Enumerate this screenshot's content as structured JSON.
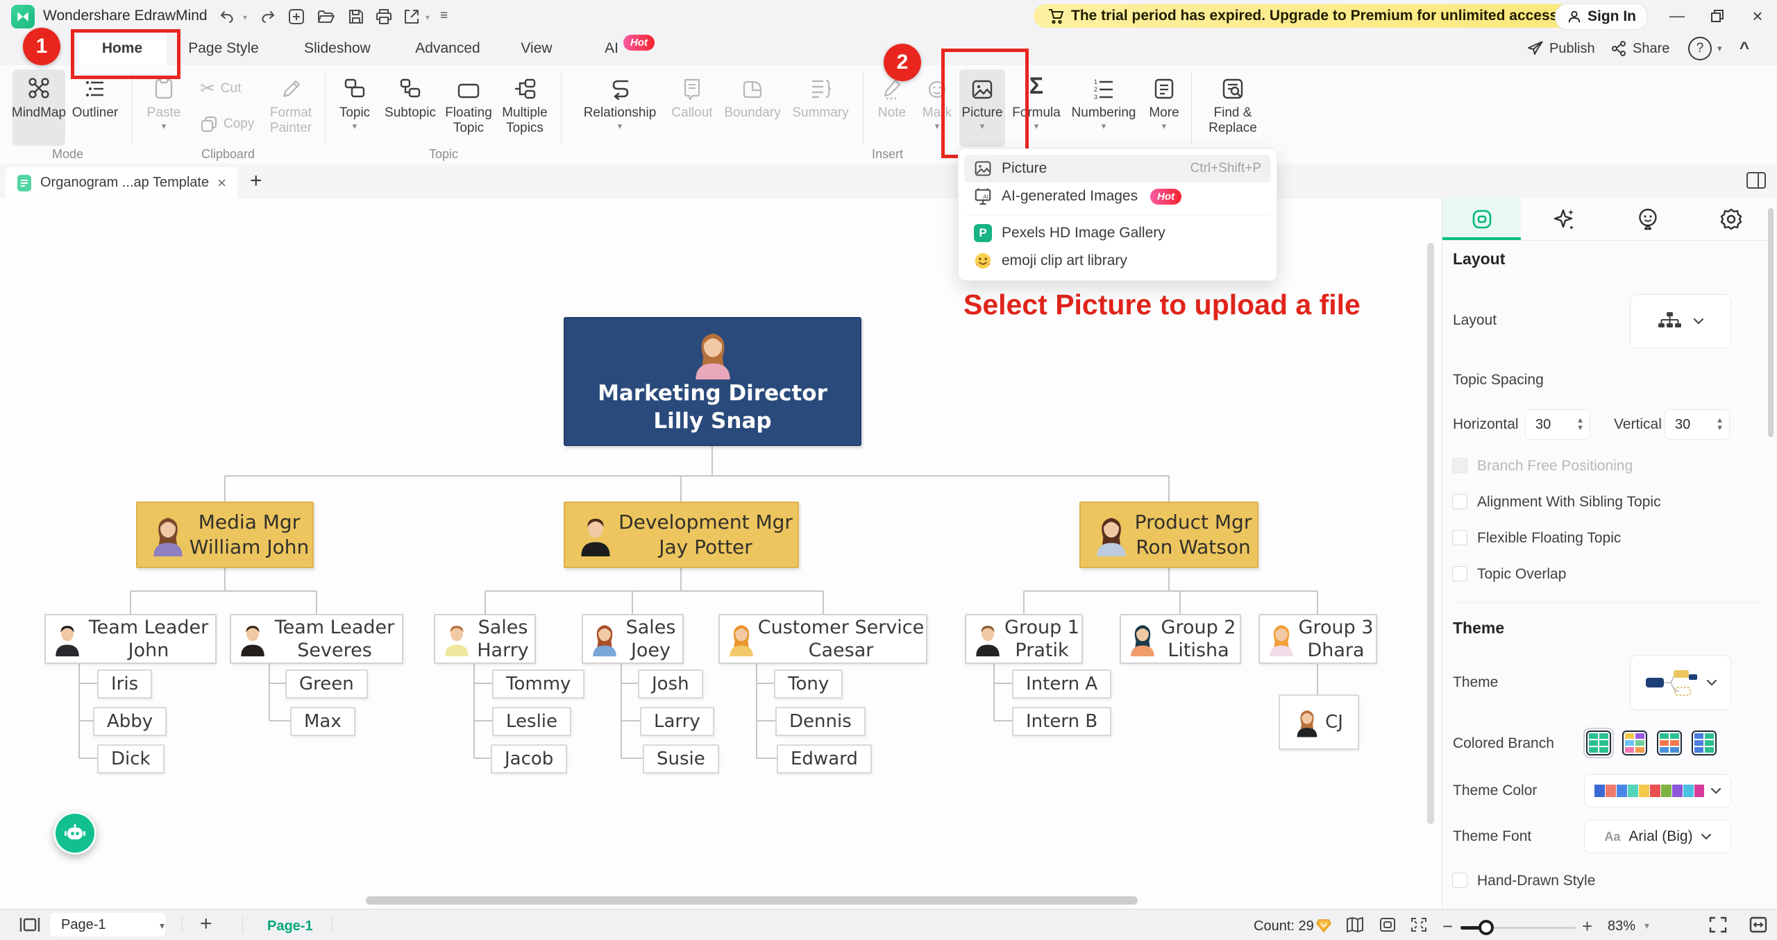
{
  "titlebar": {
    "app_title": "Wondershare EdrawMind",
    "trial_banner": "The trial period has expired. Upgrade to Premium for unlimited access.",
    "sign_in": "Sign In"
  },
  "tabs": {
    "home": "Home",
    "page_style": "Page Style",
    "slideshow": "Slideshow",
    "advanced": "Advanced",
    "view": "View",
    "ai": "AI",
    "ai_badge": "Hot"
  },
  "topright": {
    "publish": "Publish",
    "share": "Share",
    "help": "?",
    "collapse": "^"
  },
  "ribbon": {
    "mindmap": "MindMap",
    "outliner": "Outliner",
    "mode_group": "Mode",
    "paste": "Paste",
    "cut": "Cut",
    "copy": "Copy",
    "format_painter": [
      "Format",
      "Painter"
    ],
    "clipboard_group": "Clipboard",
    "topic": "Topic",
    "subtopic": "Subtopic",
    "floating_topic": [
      "Floating",
      "Topic"
    ],
    "multiple_topics": [
      "Multiple",
      "Topics"
    ],
    "topic_group": "Topic",
    "relationship": "Relationship",
    "callout": "Callout",
    "boundary": "Boundary",
    "summary": "Summary",
    "note": "Note",
    "mark": "Mark",
    "picture": "Picture",
    "formula": "Formula",
    "numbering": "Numbering",
    "more": "More",
    "insert_group": "Insert",
    "find_replace": [
      "Find &",
      "Replace"
    ]
  },
  "annotations": {
    "step1": "1",
    "step2": "2",
    "callout_text": "Select Picture to upload a file"
  },
  "doc_tab": {
    "title": "Organogram ...ap Template"
  },
  "picture_menu": {
    "items": [
      {
        "label": "Picture",
        "shortcut": "Ctrl+Shift+P"
      },
      {
        "label": "AI-generated Images",
        "badge": "Hot"
      },
      {
        "label": "Pexels HD Image Gallery"
      },
      {
        "label": "emoji clip art library"
      }
    ]
  },
  "org": {
    "root": {
      "line1": "Marketing Director",
      "line2": "Lilly Snap"
    },
    "managers": [
      {
        "line1": "Media Mgr",
        "line2": "William John"
      },
      {
        "line1": "Development Mgr",
        "line2": "Jay Potter"
      },
      {
        "line1": "Product Mgr",
        "line2": "Ron Watson"
      }
    ],
    "level3": [
      {
        "line1": "Team Leader",
        "line2": "John"
      },
      {
        "line1": "Team Leader",
        "line2": "Severes"
      },
      {
        "line1": "Sales",
        "line2": "Harry"
      },
      {
        "line1": "Sales",
        "line2": "Joey"
      },
      {
        "line1": "Customer Service",
        "line2": "Caesar"
      },
      {
        "line1": "Group 1",
        "line2": "Pratik"
      },
      {
        "line1": "Group 2",
        "line2": "Litisha"
      },
      {
        "line1": "Group 3",
        "line2": "Dhara"
      }
    ],
    "leaves": {
      "john": [
        "Iris",
        "Abby",
        "Dick"
      ],
      "severes": [
        "Green",
        "Max"
      ],
      "harry": [
        "Tommy",
        "Leslie",
        "Jacob"
      ],
      "joey": [
        "Josh",
        "Larry",
        "Susie"
      ],
      "caesar": [
        "Tony",
        "Dennis",
        "Edward"
      ],
      "pratik": [
        "Intern A",
        "Intern B"
      ],
      "dhara": [
        "CJ"
      ]
    }
  },
  "sidebar": {
    "layout_heading": "Layout",
    "layout_label": "Layout",
    "topic_spacing": "Topic Spacing",
    "horizontal": "Horizontal",
    "horizontal_value": "30",
    "vertical": "Vertical",
    "vertical_value": "30",
    "checkboxes": [
      "Branch Free Positioning",
      "Alignment With Sibling Topic",
      "Flexible Floating Topic",
      "Topic Overlap"
    ],
    "theme_heading": "Theme",
    "theme_label": "Theme",
    "colored_branch": "Colored Branch",
    "theme_color": "Theme Color",
    "theme_font": "Theme Font",
    "font_aa": "Aa",
    "theme_font_value": "Arial (Big)",
    "hand_drawn": "Hand-Drawn Style"
  },
  "statusbar": {
    "page_dropdown": "Page-1",
    "active_page": "Page-1",
    "count": "Count: 29",
    "zoom": "83%"
  },
  "icons": {
    "caret_down": "▾",
    "plus": "+",
    "minus": "−",
    "close": "×",
    "scissors": "✂",
    "sigma": "Σ",
    "collapse": "^",
    "minimize": "—",
    "menu": "≡"
  },
  "colors": {
    "accent_green": "#00c07f",
    "annotation_red": "#e8261d",
    "root_navy": "#2a4a7b",
    "manager_gold": "#ecc55e",
    "trial_yellow": "#fbe87c",
    "hot_badge": "#f5232d"
  }
}
